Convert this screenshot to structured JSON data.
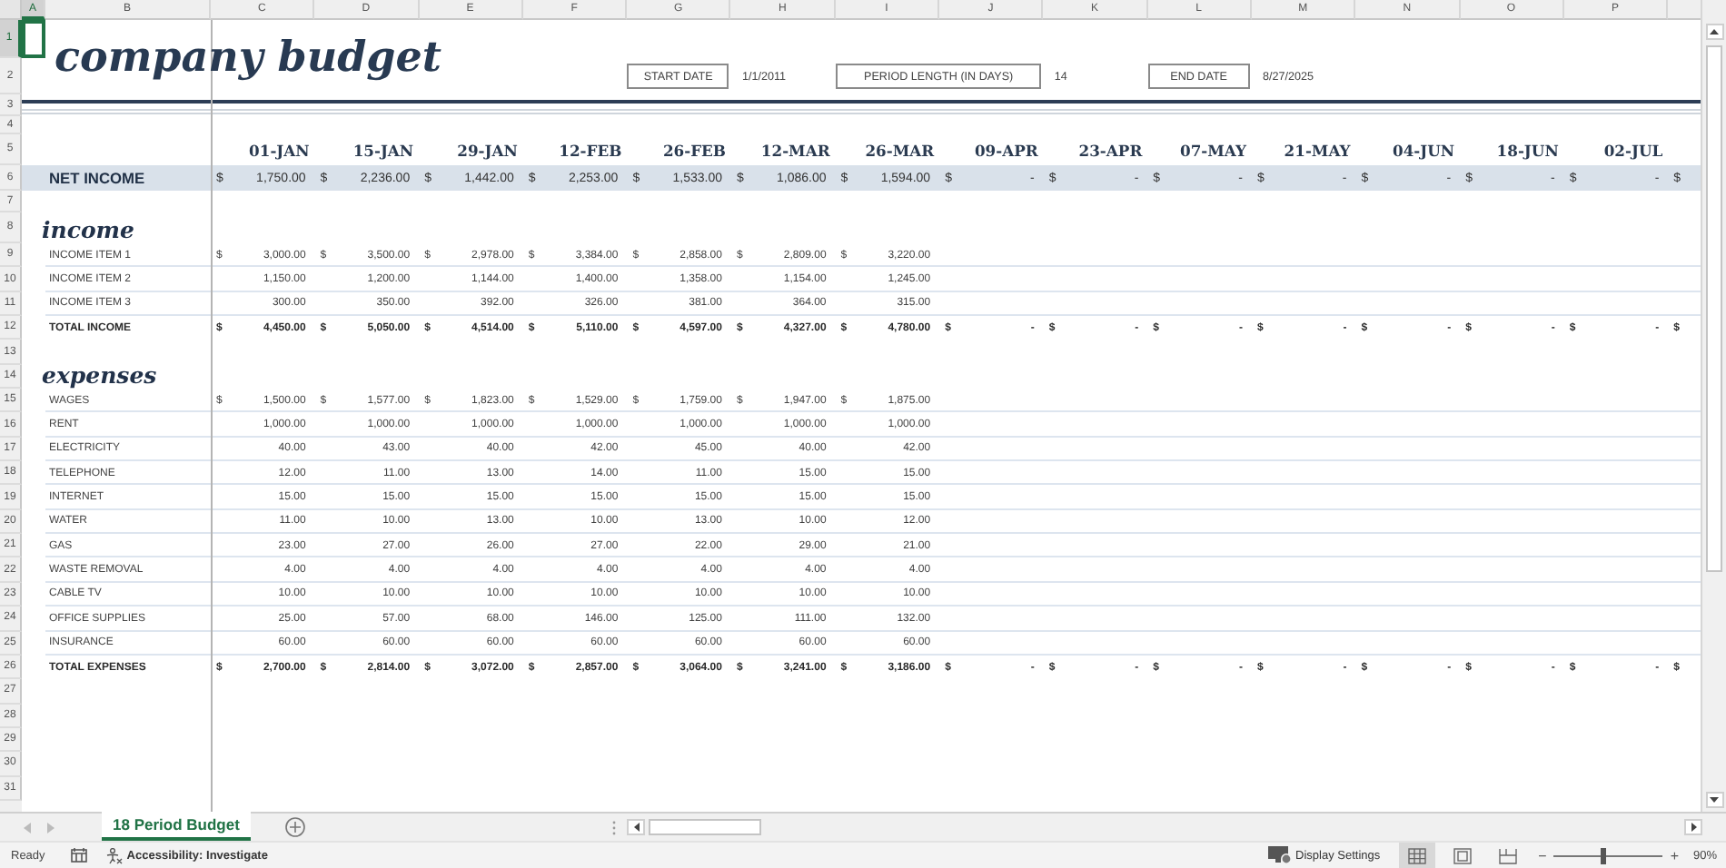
{
  "column_headers": [
    {
      "label": "A",
      "selected": true
    },
    {
      "label": "B",
      "selected": false
    },
    {
      "label": "C",
      "selected": false
    },
    {
      "label": "D",
      "selected": false
    },
    {
      "label": "E",
      "selected": false
    },
    {
      "label": "F",
      "selected": false
    },
    {
      "label": "G",
      "selected": false
    },
    {
      "label": "H",
      "selected": false
    },
    {
      "label": "I",
      "selected": false
    },
    {
      "label": "J",
      "selected": false
    },
    {
      "label": "K",
      "selected": false
    },
    {
      "label": "L",
      "selected": false
    },
    {
      "label": "M",
      "selected": false
    },
    {
      "label": "N",
      "selected": false
    },
    {
      "label": "O",
      "selected": false
    },
    {
      "label": "P",
      "selected": false
    }
  ],
  "row_headers": [
    {
      "label": "1",
      "selected": true
    },
    {
      "label": "2",
      "selected": false
    },
    {
      "label": "3",
      "selected": false
    },
    {
      "label": "4",
      "selected": false
    },
    {
      "label": "5",
      "selected": false
    },
    {
      "label": "6",
      "selected": false
    },
    {
      "label": "7",
      "selected": false
    },
    {
      "label": "8",
      "selected": false
    },
    {
      "label": "9",
      "selected": false
    },
    {
      "label": "10",
      "selected": false
    },
    {
      "label": "11",
      "selected": false
    },
    {
      "label": "12",
      "selected": false
    },
    {
      "label": "13",
      "selected": false
    },
    {
      "label": "14",
      "selected": false
    },
    {
      "label": "15",
      "selected": false
    },
    {
      "label": "16",
      "selected": false
    },
    {
      "label": "17",
      "selected": false
    },
    {
      "label": "18",
      "selected": false
    },
    {
      "label": "19",
      "selected": false
    },
    {
      "label": "20",
      "selected": false
    },
    {
      "label": "21",
      "selected": false
    },
    {
      "label": "22",
      "selected": false
    },
    {
      "label": "23",
      "selected": false
    },
    {
      "label": "24",
      "selected": false
    },
    {
      "label": "25",
      "selected": false
    },
    {
      "label": "26",
      "selected": false
    },
    {
      "label": "27",
      "selected": false
    },
    {
      "label": "28",
      "selected": false
    },
    {
      "label": "29",
      "selected": false
    },
    {
      "label": "30",
      "selected": false
    },
    {
      "label": "31",
      "selected": false
    }
  ],
  "title": "company budget",
  "settings": [
    {
      "label": "START DATE",
      "value": "1/1/2011"
    },
    {
      "label": "PERIOD LENGTH (IN DAYS)",
      "value": "14"
    },
    {
      "label": "END DATE",
      "value": "8/27/2025"
    }
  ],
  "periods": [
    "01-JAN",
    "15-JAN",
    "29-JAN",
    "12-FEB",
    "26-FEB",
    "12-MAR",
    "26-MAR",
    "09-APR",
    "23-APR",
    "07-MAY",
    "21-MAY",
    "04-JUN",
    "18-JUN",
    "02-JUL"
  ],
  "rows": [
    {
      "kind": "net",
      "label": "NET INCOME",
      "cells": [
        {
          "currency": "$",
          "amount": "1,750.00"
        },
        {
          "currency": "$",
          "amount": "2,236.00"
        },
        {
          "currency": "$",
          "amount": "1,442.00"
        },
        {
          "currency": "$",
          "amount": "2,253.00"
        },
        {
          "currency": "$",
          "amount": "1,533.00"
        },
        {
          "currency": "$",
          "amount": "1,086.00"
        },
        {
          "currency": "$",
          "amount": "1,594.00"
        },
        {
          "currency": "$",
          "amount": "-"
        },
        {
          "currency": "$",
          "amount": "-"
        },
        {
          "currency": "$",
          "amount": "-"
        },
        {
          "currency": "$",
          "amount": "-"
        },
        {
          "currency": "$",
          "amount": "-"
        },
        {
          "currency": "$",
          "amount": "-"
        },
        {
          "currency": "$",
          "amount": "-"
        },
        {
          "currency": "$"
        }
      ]
    },
    {
      "kind": "blank"
    },
    {
      "kind": "heading",
      "label": "income"
    },
    {
      "kind": "item",
      "label": "INCOME ITEM 1",
      "cells": [
        {
          "currency": "$",
          "amount": "3,000.00"
        },
        {
          "currency": "$",
          "amount": "3,500.00"
        },
        {
          "currency": "$",
          "amount": "2,978.00"
        },
        {
          "currency": "$",
          "amount": "3,384.00"
        },
        {
          "currency": "$",
          "amount": "2,858.00"
        },
        {
          "currency": "$",
          "amount": "2,809.00"
        },
        {
          "currency": "$",
          "amount": "3,220.00"
        }
      ]
    },
    {
      "kind": "item",
      "label": "INCOME ITEM 2",
      "cells": [
        {
          "amount": "1,150.00"
        },
        {
          "amount": "1,200.00"
        },
        {
          "amount": "1,144.00"
        },
        {
          "amount": "1,400.00"
        },
        {
          "amount": "1,358.00"
        },
        {
          "amount": "1,154.00"
        },
        {
          "amount": "1,245.00"
        }
      ]
    },
    {
      "kind": "item",
      "label": "INCOME ITEM 3",
      "cells": [
        {
          "amount": "300.00"
        },
        {
          "amount": "350.00"
        },
        {
          "amount": "392.00"
        },
        {
          "amount": "326.00"
        },
        {
          "amount": "381.00"
        },
        {
          "amount": "364.00"
        },
        {
          "amount": "315.00"
        }
      ]
    },
    {
      "kind": "total",
      "label": "TOTAL INCOME",
      "cells": [
        {
          "currency": "$",
          "amount": "4,450.00"
        },
        {
          "currency": "$",
          "amount": "5,050.00"
        },
        {
          "currency": "$",
          "amount": "4,514.00"
        },
        {
          "currency": "$",
          "amount": "5,110.00"
        },
        {
          "currency": "$",
          "amount": "4,597.00"
        },
        {
          "currency": "$",
          "amount": "4,327.00"
        },
        {
          "currency": "$",
          "amount": "4,780.00"
        },
        {
          "currency": "$",
          "amount": "-"
        },
        {
          "currency": "$",
          "amount": "-"
        },
        {
          "currency": "$",
          "amount": "-"
        },
        {
          "currency": "$",
          "amount": "-"
        },
        {
          "currency": "$",
          "amount": "-"
        },
        {
          "currency": "$",
          "amount": "-"
        },
        {
          "currency": "$",
          "amount": "-"
        },
        {
          "currency": "$"
        }
      ]
    },
    {
      "kind": "blank"
    },
    {
      "kind": "heading",
      "label": "expenses"
    },
    {
      "kind": "item",
      "label": "WAGES",
      "cells": [
        {
          "currency": "$",
          "amount": "1,500.00"
        },
        {
          "currency": "$",
          "amount": "1,577.00"
        },
        {
          "currency": "$",
          "amount": "1,823.00"
        },
        {
          "currency": "$",
          "amount": "1,529.00"
        },
        {
          "currency": "$",
          "amount": "1,759.00"
        },
        {
          "currency": "$",
          "amount": "1,947.00"
        },
        {
          "currency": "$",
          "amount": "1,875.00"
        }
      ]
    },
    {
      "kind": "item",
      "label": "RENT",
      "cells": [
        {
          "amount": "1,000.00"
        },
        {
          "amount": "1,000.00"
        },
        {
          "amount": "1,000.00"
        },
        {
          "amount": "1,000.00"
        },
        {
          "amount": "1,000.00"
        },
        {
          "amount": "1,000.00"
        },
        {
          "amount": "1,000.00"
        }
      ]
    },
    {
      "kind": "item",
      "label": "ELECTRICITY",
      "cells": [
        {
          "amount": "40.00"
        },
        {
          "amount": "43.00"
        },
        {
          "amount": "40.00"
        },
        {
          "amount": "42.00"
        },
        {
          "amount": "45.00"
        },
        {
          "amount": "40.00"
        },
        {
          "amount": "42.00"
        }
      ]
    },
    {
      "kind": "item",
      "label": "TELEPHONE",
      "cells": [
        {
          "amount": "12.00"
        },
        {
          "amount": "11.00"
        },
        {
          "amount": "13.00"
        },
        {
          "amount": "14.00"
        },
        {
          "amount": "11.00"
        },
        {
          "amount": "15.00"
        },
        {
          "amount": "15.00"
        }
      ]
    },
    {
      "kind": "item",
      "label": "INTERNET",
      "cells": [
        {
          "amount": "15.00"
        },
        {
          "amount": "15.00"
        },
        {
          "amount": "15.00"
        },
        {
          "amount": "15.00"
        },
        {
          "amount": "15.00"
        },
        {
          "amount": "15.00"
        },
        {
          "amount": "15.00"
        }
      ]
    },
    {
      "kind": "item",
      "label": "WATER",
      "cells": [
        {
          "amount": "11.00"
        },
        {
          "amount": "10.00"
        },
        {
          "amount": "13.00"
        },
        {
          "amount": "10.00"
        },
        {
          "amount": "13.00"
        },
        {
          "amount": "10.00"
        },
        {
          "amount": "12.00"
        }
      ]
    },
    {
      "kind": "item",
      "label": "GAS",
      "cells": [
        {
          "amount": "23.00"
        },
        {
          "amount": "27.00"
        },
        {
          "amount": "26.00"
        },
        {
          "amount": "27.00"
        },
        {
          "amount": "22.00"
        },
        {
          "amount": "29.00"
        },
        {
          "amount": "21.00"
        }
      ]
    },
    {
      "kind": "item",
      "label": "WASTE REMOVAL",
      "cells": [
        {
          "amount": "4.00"
        },
        {
          "amount": "4.00"
        },
        {
          "amount": "4.00"
        },
        {
          "amount": "4.00"
        },
        {
          "amount": "4.00"
        },
        {
          "amount": "4.00"
        },
        {
          "amount": "4.00"
        }
      ]
    },
    {
      "kind": "item",
      "label": "CABLE TV",
      "cells": [
        {
          "amount": "10.00"
        },
        {
          "amount": "10.00"
        },
        {
          "amount": "10.00"
        },
        {
          "amount": "10.00"
        },
        {
          "amount": "10.00"
        },
        {
          "amount": "10.00"
        },
        {
          "amount": "10.00"
        }
      ]
    },
    {
      "kind": "item",
      "label": "OFFICE SUPPLIES",
      "cells": [
        {
          "amount": "25.00"
        },
        {
          "amount": "57.00"
        },
        {
          "amount": "68.00"
        },
        {
          "amount": "146.00"
        },
        {
          "amount": "125.00"
        },
        {
          "amount": "111.00"
        },
        {
          "amount": "132.00"
        }
      ]
    },
    {
      "kind": "item",
      "label": "INSURANCE",
      "cells": [
        {
          "amount": "60.00"
        },
        {
          "amount": "60.00"
        },
        {
          "amount": "60.00"
        },
        {
          "amount": "60.00"
        },
        {
          "amount": "60.00"
        },
        {
          "amount": "60.00"
        },
        {
          "amount": "60.00"
        }
      ]
    },
    {
      "kind": "total",
      "label": "TOTAL EXPENSES",
      "cells": [
        {
          "currency": "$",
          "amount": "2,700.00"
        },
        {
          "currency": "$",
          "amount": "2,814.00"
        },
        {
          "currency": "$",
          "amount": "3,072.00"
        },
        {
          "currency": "$",
          "amount": "2,857.00"
        },
        {
          "currency": "$",
          "amount": "3,064.00"
        },
        {
          "currency": "$",
          "amount": "3,241.00"
        },
        {
          "currency": "$",
          "amount": "3,186.00"
        },
        {
          "currency": "$",
          "amount": "-"
        },
        {
          "currency": "$",
          "amount": "-"
        },
        {
          "currency": "$",
          "amount": "-"
        },
        {
          "currency": "$",
          "amount": "-"
        },
        {
          "currency": "$",
          "amount": "-"
        },
        {
          "currency": "$",
          "amount": "-"
        },
        {
          "currency": "$",
          "amount": "-"
        },
        {
          "currency": "$"
        }
      ]
    }
  ],
  "sheet_tabs": [
    {
      "label": "18 Period Budget",
      "selected": true
    }
  ],
  "status_bar": {
    "mode": "Ready",
    "accessibility": "Accessibility: Investigate",
    "display_settings": "Display Settings",
    "views": [
      {
        "kind": "normal",
        "selected": true
      },
      {
        "kind": "page_layout",
        "selected": false
      },
      {
        "kind": "page_break",
        "selected": false
      }
    ],
    "zoom_out": "−",
    "zoom_in": "+",
    "zoom": {
      "level": 0.45,
      "label": "90%"
    }
  }
}
